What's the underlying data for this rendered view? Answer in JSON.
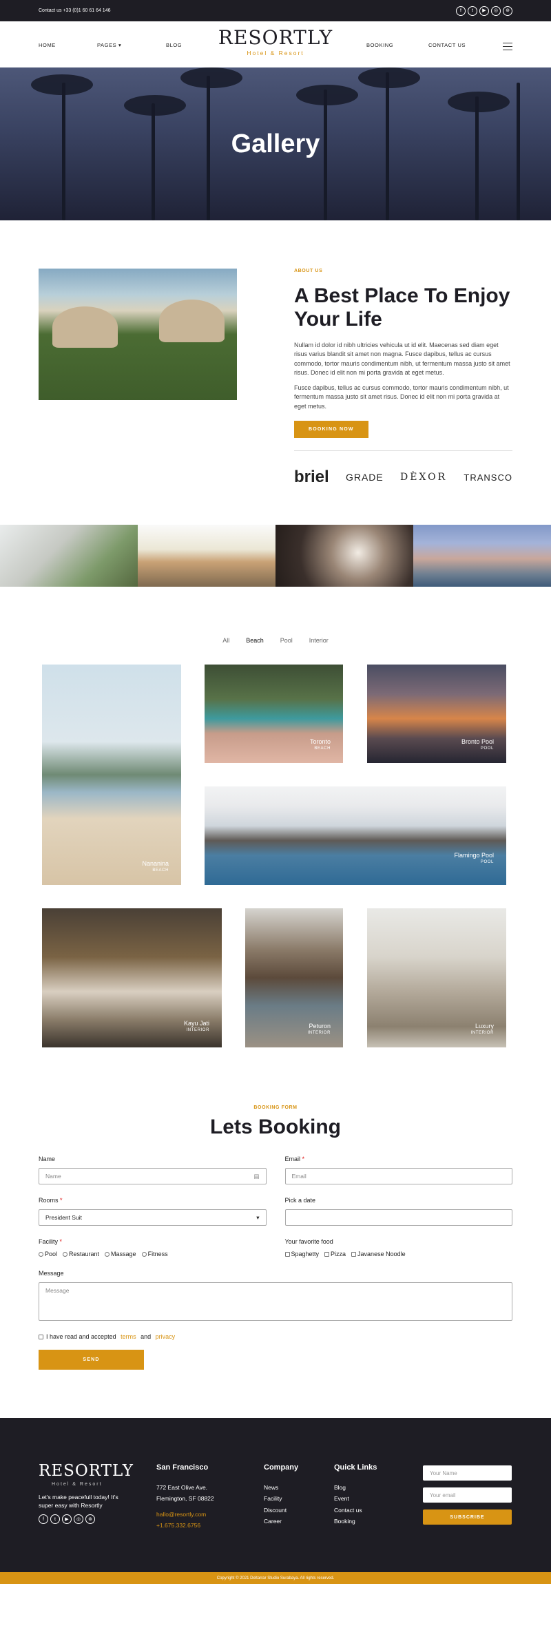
{
  "topbar": {
    "contact": "Contact us +33 (0)1 60 61 64 146",
    "social_icons": [
      "facebook-icon",
      "twitter-icon",
      "youtube-icon",
      "instagram-icon",
      "dribbble-icon"
    ]
  },
  "nav": {
    "items": [
      "HOME",
      "PAGES",
      "BLOG",
      "BOOKING",
      "CONTACT US"
    ],
    "logo": "RESORTLY",
    "logo_sub": "Hotel & Resort"
  },
  "hero": {
    "title": "Gallery"
  },
  "about": {
    "eyebrow": "ABOUT US",
    "title": "A Best Place To Enjoy Your Life",
    "p1": "Nullam id dolor id nibh ultricies vehicula ut id elit. Maecenas sed diam eget risus varius blandit sit amet non magna. Fusce dapibus, tellus ac cursus commodo, tortor mauris condimentum nibh, ut fermentum massa justo sit amet risus. Donec id elit non mi porta gravida at eget metus.",
    "p2": "Fusce dapibus, tellus ac cursus commodo, tortor mauris condimentum nibh, ut fermentum massa justo sit amet risus. Donec id elit non mi porta gravida at eget metus.",
    "button": "BOOKING NOW",
    "brands": [
      "briel",
      "GRADE",
      "DÈXOR",
      "TRANSCO"
    ]
  },
  "gallery": {
    "filters": [
      "All",
      "Beach",
      "Pool",
      "Interior"
    ],
    "active_filter": "Beach",
    "items": [
      {
        "title": "Nananina",
        "tag": "BEACH"
      },
      {
        "title": "Toronto",
        "tag": "BEACH"
      },
      {
        "title": "Bronto Pool",
        "tag": "POOL"
      },
      {
        "title": "Flamingo Pool",
        "tag": "POOL"
      },
      {
        "title": "Kayu Jati",
        "tag": "INTERIOR"
      },
      {
        "title": "Peturon",
        "tag": "INTERIOR"
      },
      {
        "title": "Luxury",
        "tag": "INTERIOR"
      }
    ]
  },
  "booking": {
    "eyebrow": "BOOKING FORM",
    "title": "Lets Booking",
    "name_label": "Name",
    "name_placeholder": "Name",
    "email_label": "Email",
    "email_placeholder": "Email",
    "rooms_label": "Rooms",
    "rooms_value": "President Suit",
    "date_label": "Pick a date",
    "facility_label": "Facility",
    "facility_options": [
      "Pool",
      "Restaurant",
      "Massage",
      "Fitness"
    ],
    "food_label": "Your favorite food",
    "food_options": [
      "Spaghetty",
      "Pizza",
      "Javanese Noodle"
    ],
    "message_label": "Message",
    "message_placeholder": "Message",
    "agree_prefix": "I have read and accepted",
    "agree_terms": "terms",
    "agree_and": "and",
    "agree_privacy": "privacy",
    "send": "SEND"
  },
  "footer": {
    "logo": "RESORTLY",
    "logo_sub": "Hotel & Resort",
    "tagline": "Let's make peacefull today! It's super easy with Resortly",
    "city": "San Francisco",
    "address1": "772 East Olive Ave.",
    "address2": "Flemington, SF 08822",
    "email": "hallo@resortly.com",
    "phone": "+1.675.332.6756",
    "company_title": "Company",
    "company_links": [
      "News",
      "Facility",
      "Discount",
      "Career"
    ],
    "quick_title": "Quick Links",
    "quick_links": [
      "Blog",
      "Event",
      "Contact us",
      "Booking"
    ],
    "newsletter_name": "Your Name",
    "newsletter_email": "Your email",
    "subscribe": "SUBSCRIBE",
    "copyright": "Copyright © 2021 Deltarrar Studio Surabaya. All rights reserved."
  },
  "colors": {
    "accent": "#d89414",
    "dark": "#1e1d24"
  }
}
